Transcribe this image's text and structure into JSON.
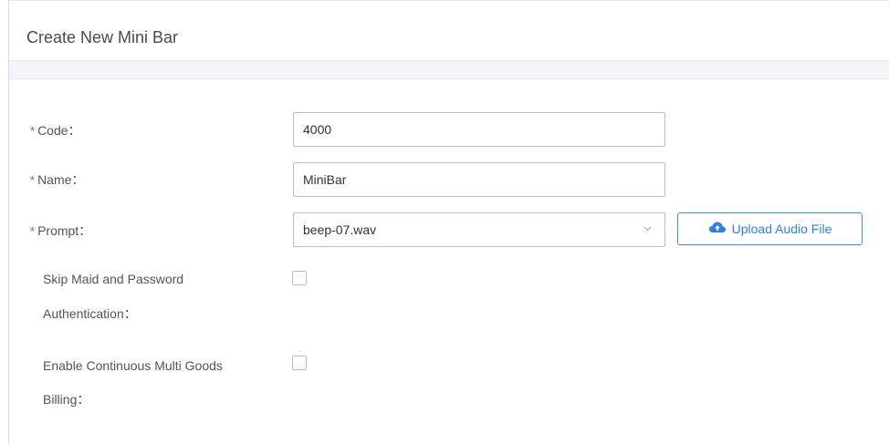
{
  "dialog": {
    "title": "Create New Mini Bar"
  },
  "form": {
    "code": {
      "required_mark": "*",
      "label": "Code：",
      "value": "4000"
    },
    "name": {
      "required_mark": "*",
      "label": "Name：",
      "value": "MiniBar"
    },
    "prompt": {
      "required_mark": "*",
      "label": "Prompt：",
      "selected": "beep-07.wav",
      "upload_button_label": "Upload Audio File",
      "upload_icon": "cloud-upload-icon",
      "dropdown_icon": "chevron-down-icon"
    },
    "skip_maid": {
      "label_line1": "Skip Maid and Password",
      "label_line2": "Authentication：",
      "checked": false
    },
    "continuous_billing": {
      "label_line1": "Enable Continuous Multi Goods",
      "label_line2": "Billing：",
      "checked": false
    }
  },
  "colors": {
    "required": "#e8472b",
    "accent": "#2f7fe8",
    "band": "#f2f5f9"
  }
}
